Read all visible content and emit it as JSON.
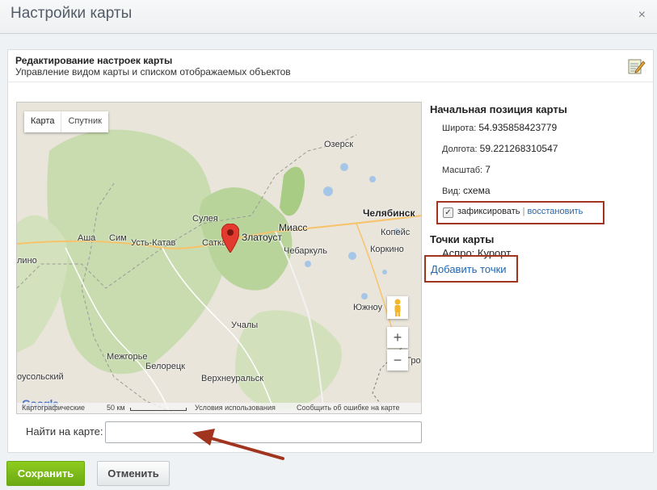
{
  "window": {
    "title": "Настройки карты",
    "close_symbol": "×"
  },
  "panel": {
    "heading": "Редактирование настроек карты",
    "subheading": "Управление видом карты и списком отображаемых объектов",
    "edit_icon": "notepad-pencil-icon"
  },
  "map": {
    "type_buttons": [
      "Карта",
      "Спутник"
    ],
    "labels": {
      "ozersk": "Озерск",
      "zlatoust": "Златоуст",
      "chelyabinsk": "Челябинск",
      "sulea": "Сулея",
      "miass": "Миасс",
      "kopeysk": "Копейс",
      "asha": "Аша",
      "sim": "Сим",
      "ust_katav": "Усть-Катав",
      "satka": "Сатка",
      "chebarkul": "Чебаркуль",
      "korkino": "Коркино",
      "lino": "лино",
      "yuzhnour": "Южноу",
      "uchaly": "Учалы",
      "mezhgorye": "Межгорье",
      "beloretsk": "Белорецк",
      "gro": "Гро",
      "ousolsky": "оусольский",
      "verkhneuralsk": "Верхнеуральск"
    },
    "zoom_in": "+",
    "zoom_out": "−",
    "footer": {
      "logo": "Google",
      "cartographic": "Картографические",
      "scale": "50 км",
      "terms": "Условия использования",
      "report": "Сообщить об ошибке на карте"
    },
    "marker_icon": "map-pin-icon",
    "pegman_icon": "pegman-icon"
  },
  "position": {
    "title": "Начальная позиция карты",
    "lat_label": "Широта:",
    "lat_value": "54.935858423779",
    "lon_label": "Долгота:",
    "lon_value": "59.221268310547",
    "zoom_label": "Масштаб:",
    "zoom_value": "7",
    "view_label": "Вид:",
    "view_value": "схема",
    "fix_label": "зафиксировать",
    "separator": "|",
    "restore_label": "восстановить"
  },
  "points": {
    "title": "Точки карты",
    "items": [
      "Аспро: Курорт"
    ],
    "add_label": "Добавить точки"
  },
  "search": {
    "label": "Найти на карте:",
    "value": "",
    "placeholder": ""
  },
  "actions": {
    "save_label": "Сохранить",
    "cancel_label": "Отменить"
  },
  "colors": {
    "save_green": "#7ab91a",
    "link_blue": "#2067b0",
    "highlight_red": "#a0341f"
  }
}
